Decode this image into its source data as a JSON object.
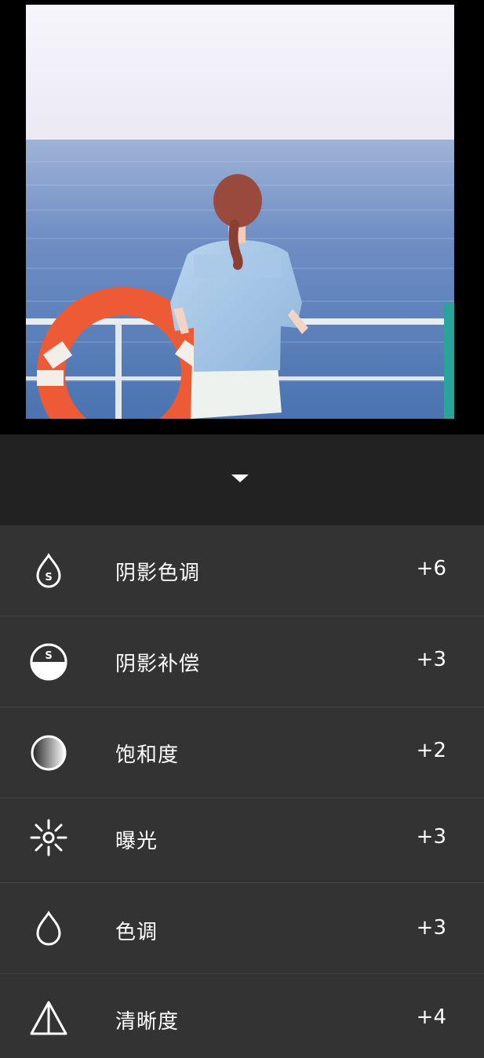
{
  "photo": {
    "description_icon": "photo-preview"
  },
  "toolbar": {
    "collapse_icon": "chevron-down-icon"
  },
  "adjustments": [
    {
      "icon": "shadow-tint-drop-icon",
      "label": "阴影色调",
      "value": "+6"
    },
    {
      "icon": "shadow-compensation-icon",
      "label": "阴影补偿",
      "value": "+3"
    },
    {
      "icon": "saturation-icon",
      "label": "饱和度",
      "value": "+2"
    },
    {
      "icon": "exposure-sun-icon",
      "label": "曝光",
      "value": "+3"
    },
    {
      "icon": "tone-drop-icon",
      "label": "色调",
      "value": "+3"
    },
    {
      "icon": "sharpness-triangle-icon",
      "label": "清晰度",
      "value": "+4"
    }
  ],
  "colors": {
    "panel_bg": "#333333",
    "header_bg": "#222222",
    "text": "#ffffff"
  }
}
